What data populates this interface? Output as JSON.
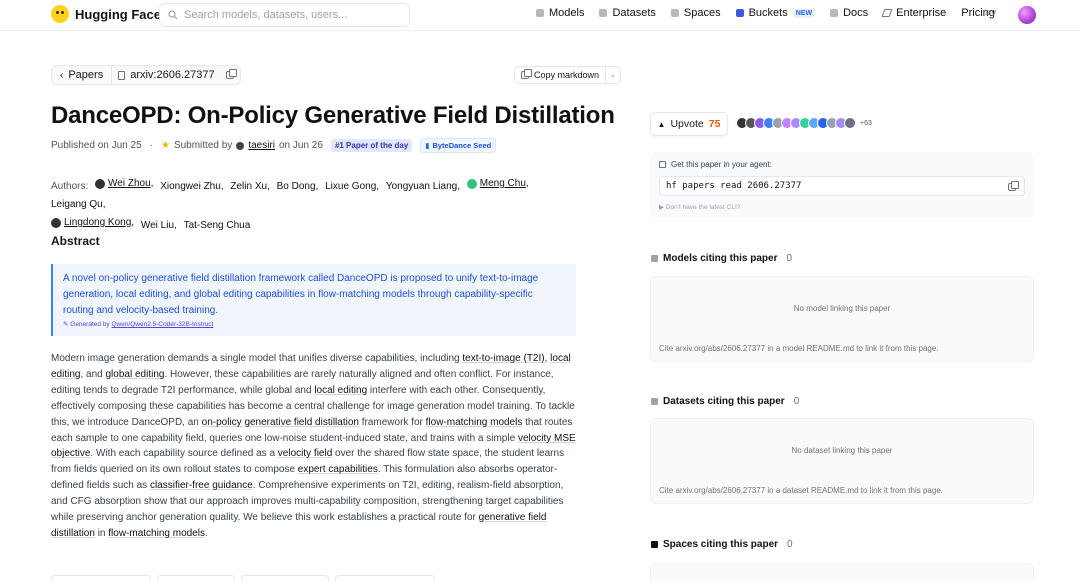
{
  "nav": {
    "brand": "Hugging Face",
    "search_placeholder": "Search models, datasets, users...",
    "links": [
      "Models",
      "Datasets",
      "Spaces",
      "Buckets",
      "Docs",
      "Enterprise",
      "Pricing"
    ],
    "new_badge": "NEW"
  },
  "breadcrumb": {
    "back_label": "Papers",
    "arxiv_label": "arxiv:2606.27377"
  },
  "copy_markdown_label": "Copy markdown",
  "paper": {
    "title": "DanceOPD: On-Policy Generative Field Distillation",
    "published": "Published on Jun 25",
    "submitted_prefix": "Submitted by",
    "submitter": "taesiri",
    "submitted_date": "on Jun 26",
    "badge_day": "#1 Paper of the day",
    "badge_org": "ByteDance Seed",
    "authors_label": "Authors:",
    "authors": [
      "Wei Zhou",
      "Xiongwei Zhu",
      "Zelin Xu",
      "Bo Dong",
      "Lixue Gong",
      "Yongyuan Liang",
      "Meng Chu",
      "Leigang Qu",
      "Lingdong Kong",
      "Wei Liu",
      "Tat-Seng Chua"
    ],
    "abstract_heading": "Abstract",
    "ai_summary": "A novel on-policy generative field distillation framework called DanceOPD is proposed to unify text-to-image generation, local editing, and global editing capabilities in flow-matching models through capability-specific routing and velocity-based training.",
    "generated_by_prefix": "Generated by",
    "generated_by_model": "Qwen/Qwen2.5-Coder-32B-Instruct",
    "abstract_parts": [
      "Modern image generation demands a single model that unifies diverse capabilities, including ",
      "text-to-image (T2I)",
      ", ",
      "local editing",
      ", and ",
      "global editing",
      ". However, these capabilities are rarely naturally aligned and often conflict. For instance, editing tends to degrade T2I performance, while global and ",
      "local editing",
      " interfere with each other. Consequently, effectively composing these capabilities has become a central challenge for image generation model training. To tackle this, we introduce DanceOPD, an ",
      "on-policy generative field distillation",
      " framework for ",
      "flow-matching models",
      " that routes each sample to one capability field, queries one low-noise student-induced state, and trains with a simple ",
      "velocity MSE objective",
      ". With each capability source defined as a ",
      "velocity field",
      " over the shared flow state space, the student learns from fields queried on its own rollout states to compose ",
      "expert capabilities",
      ". This formulation also absorbs operator-defined fields such as ",
      "classifier-free guidance",
      ". Comprehensive experiments on T2I, editing, realism-field absorption, and CFG absorption show that our approach improves multi-capability composition, strengthening target capabilities while preserving anchor generation quality. We believe this work establishes a practical route for ",
      "generative field distillation",
      " in ",
      "flow-matching models",
      "."
    ]
  },
  "sidebar": {
    "upvote_label": "Upvote",
    "upvote_count": "75",
    "voters_more": "+63",
    "voter_colors": [
      "#333333",
      "#555555",
      "#8b5cf6",
      "#3b82f6",
      "#9ca3af",
      "#c084fc",
      "#a78bfa",
      "#34d399",
      "#60a5fa",
      "#2563eb",
      "#94a3b8",
      "#a78bfa",
      "#6b7280"
    ],
    "agent_label": "Get this paper in your agent:",
    "agent_command": "hf papers read 2606.27377",
    "agent_hint": "▶ Don't have the latest CLI?",
    "models_heading": "Models citing this paper",
    "models_count": "0",
    "models_empty": "No model linking this paper",
    "models_cite": "Cite arxiv.org/abs/2606.27377 in a model README.md to link it from this page.",
    "datasets_heading": "Datasets citing this paper",
    "datasets_count": "0",
    "datasets_empty": "No dataset linking this paper",
    "datasets_cite": "Cite arxiv.org/abs/2606.27377 in a dataset README.md to link it from this page.",
    "spaces_heading": "Spaces citing this paper",
    "spaces_count": "0"
  }
}
